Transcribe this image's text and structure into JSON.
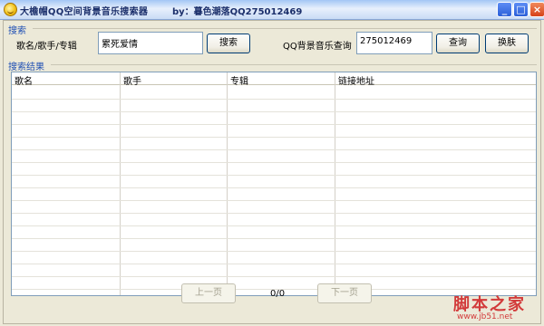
{
  "window": {
    "title": "大檐帽QQ空间背景音乐搜索器",
    "credit": "by：暮色潮落QQ275012469",
    "minimize_glyph": "_",
    "maximize_glyph": "□",
    "close_glyph": "×"
  },
  "search": {
    "section_label": "搜索",
    "field_label": "歌名/歌手/专辑",
    "query_value": "累死爱情",
    "search_button": "搜索",
    "qq_label": "QQ背景音乐查询",
    "qq_value": "275012469",
    "query_button": "查询",
    "skin_button": "换肤"
  },
  "results": {
    "section_label": "搜索结果",
    "columns": [
      "歌名",
      "歌手",
      "专辑",
      "链接地址"
    ],
    "rows": []
  },
  "pager": {
    "prev_label": "上一页",
    "page_indicator": "0/0",
    "next_label": "下一页"
  },
  "watermark": {
    "main": "脚本之家",
    "sub": "www.jb51.net"
  },
  "colors": {
    "section_label": "#1f4fb4",
    "title_text": "#1b2f6b",
    "watermark": "#d23a3a"
  }
}
